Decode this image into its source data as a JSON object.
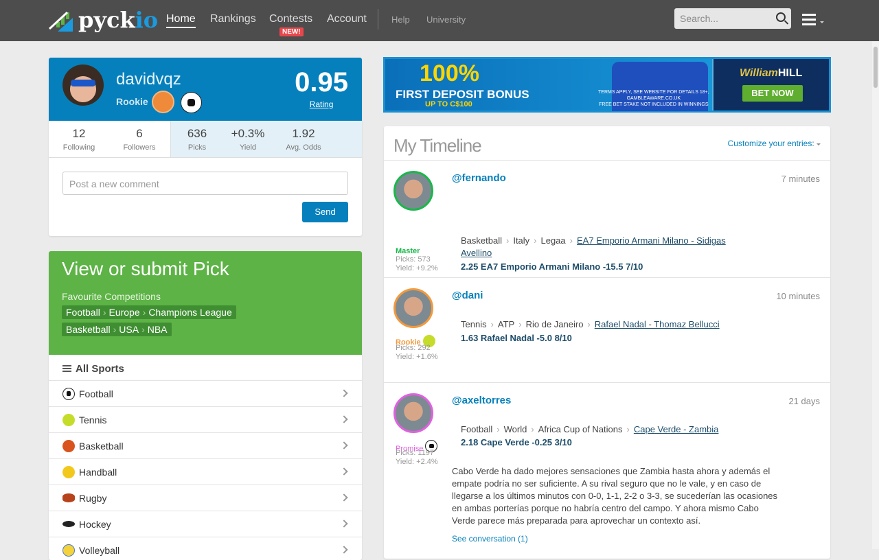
{
  "header": {
    "logo": "pyck",
    "logo_accent": "io",
    "nav": [
      "Home",
      "Rankings",
      "Contests",
      "Account"
    ],
    "nav_small": [
      "Help",
      "University"
    ],
    "new_badge": "NEW!",
    "search_placeholder": "Search..."
  },
  "profile": {
    "username": "davidvqz",
    "rank": "Rookie",
    "rating": "0.95",
    "rating_label": "Rating",
    "stats": [
      {
        "v": "12",
        "l": "Following"
      },
      {
        "v": "6",
        "l": "Followers"
      },
      {
        "v": "636",
        "l": "Picks"
      },
      {
        "v": "+0.3%",
        "l": "Yield"
      },
      {
        "v": "1.92",
        "l": "Avg. Odds"
      }
    ],
    "comment_placeholder": "Post a new comment",
    "send": "Send"
  },
  "pick": {
    "title": "View or submit Pick",
    "fav_label": "Favourite Competitions",
    "favs": [
      [
        "Football",
        "Europe",
        "Champions League"
      ],
      [
        "Basketball",
        "USA",
        "NBA"
      ]
    ],
    "all_sports": "All Sports",
    "sports": [
      "Football",
      "Tennis",
      "Basketball",
      "Handball",
      "Rugby",
      "Hockey",
      "Volleyball"
    ]
  },
  "ad": {
    "line1": "100%",
    "line2": "FIRST DEPOSIT BONUS",
    "line3": "UP TO C$100",
    "terms1": "TERMS APPLY, SEE WEBSITE FOR DETAILS 18+,",
    "terms2": "GAMBLEAWARE.CO.UK",
    "terms3": "FREE BET STAKE NOT INCLUDED IN WINNINGS",
    "brand1": "William",
    "brand2": "HILL",
    "cta": "BET NOW"
  },
  "timeline": {
    "title": "My Timeline",
    "customize": "Customize your entries:",
    "entries": [
      {
        "user": "@fernando",
        "time": "7 minutes",
        "rank": "Master",
        "picks": "Picks: 573",
        "yield": "Yield: +9.2%",
        "crumbs": [
          "Basketball",
          "Italy",
          "Legaa"
        ],
        "event": "EA7 Emporio Armani Milano - Sidigas Avellino",
        "pick": "2.25 EA7 Emporio Armani Milano -15.5   7/10"
      },
      {
        "user": "@dani",
        "time": "10 minutes",
        "rank": "Rookie",
        "picks": "Picks: 292",
        "yield": "Yield: +1.6%",
        "crumbs": [
          "Tennis",
          "ATP",
          "Rio de Janeiro"
        ],
        "event": "Rafael Nadal - Thomaz Bellucci",
        "pick": "1.63 Rafael Nadal -5.0   8/10"
      },
      {
        "user": "@axeltorres",
        "time": "21 days",
        "rank": "Promise",
        "picks": "Picks: 1197",
        "yield": "Yield: +2.4%",
        "crumbs": [
          "Football",
          "World",
          "Africa Cup of Nations"
        ],
        "event": "Cape Verde - Zambia",
        "pick": "2.18 Cape Verde -0.25   3/10",
        "text": "Cabo Verde ha dado mejores sensaciones que Zambia hasta ahora y además el empate podría no ser suficiente. A su rival seguro que no le vale, y en caso de llegarse a los últimos minutos con 0-0, 1-1, 2-2 o 3-3, se sucederían las ocasiones en ambas porterías porque no habría centro del campo. Y ahora mismo Cabo Verde parece más preparada para aprovechar un contexto así.",
        "conversation": "See conversation (1)"
      }
    ]
  },
  "colors": {
    "brand": "#0580bc",
    "green": "#5db346",
    "master": "#19b84a",
    "rookie": "#f39a3c",
    "promise": "#e160e0"
  }
}
